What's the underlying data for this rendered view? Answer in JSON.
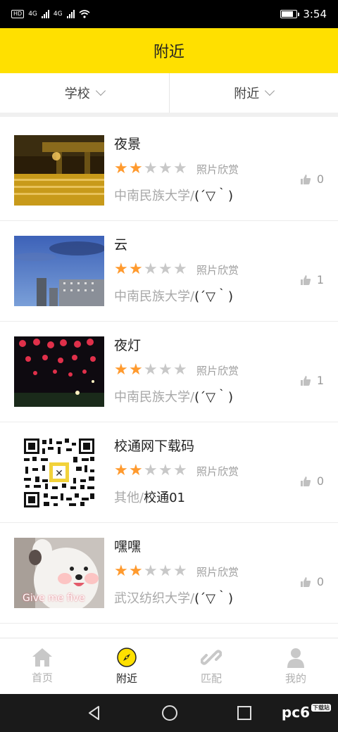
{
  "status_bar": {
    "left_text": "HD",
    "network_a": "4G",
    "network_b": "4G",
    "time": "3:54"
  },
  "header": {
    "title": "附近"
  },
  "filters": [
    {
      "label": "学校"
    },
    {
      "label": "附近"
    }
  ],
  "items": [
    {
      "title": "夜景",
      "rating": 2,
      "category": "照片欣赏",
      "school": "中南民族大学",
      "separator": "/",
      "user": "(´▽｀)",
      "likes": "0"
    },
    {
      "title": "云",
      "rating": 2,
      "category": "照片欣赏",
      "school": "中南民族大学",
      "separator": "/",
      "user": "(´▽｀)",
      "likes": "1"
    },
    {
      "title": "夜灯",
      "rating": 2,
      "category": "照片欣赏",
      "school": "中南民族大学",
      "separator": "/",
      "user": "(´▽｀)",
      "likes": "1"
    },
    {
      "title": "校通网下载码",
      "rating": 2,
      "category": "照片欣赏",
      "school": "其他",
      "separator": "/",
      "user": "校通01",
      "likes": "0"
    },
    {
      "title": "嘿嘿",
      "rating": 2,
      "category": "照片欣赏",
      "school": "武汉纺织大学",
      "separator": "/",
      "user": "(´▽｀)",
      "likes": "0",
      "thumb_caption": "Give me five"
    }
  ],
  "tabs": [
    {
      "label": "首页",
      "icon": "home-icon"
    },
    {
      "label": "附近",
      "icon": "compass-icon"
    },
    {
      "label": "匹配",
      "icon": "link-icon"
    },
    {
      "label": "我的",
      "icon": "user-icon"
    }
  ],
  "active_tab": "附近",
  "brand": {
    "text": "pc6",
    "badge": "下载站"
  },
  "colors": {
    "accent": "#ffe000",
    "star_on": "#ff9a2e",
    "star_off": "#c8c8c8"
  }
}
